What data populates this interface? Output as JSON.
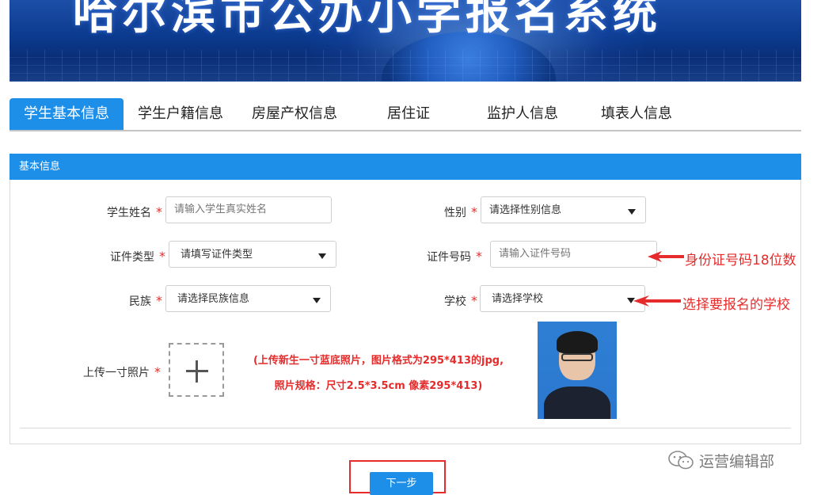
{
  "banner": {
    "title": "哈尔滨市公办小学报名系统"
  },
  "tabs": [
    {
      "label": "学生基本信息",
      "active": true
    },
    {
      "label": "学生户籍信息",
      "active": false
    },
    {
      "label": "房屋产权信息",
      "active": false
    },
    {
      "label": "居住证",
      "active": false
    },
    {
      "label": "监护人信息",
      "active": false
    },
    {
      "label": "填表人信息",
      "active": false
    }
  ],
  "panel": {
    "title": "基本信息",
    "required_mark": "*",
    "fields": {
      "student_name": {
        "label": "学生姓名",
        "placeholder": "请输入学生真实姓名"
      },
      "gender": {
        "label": "性别",
        "value": "请选择性别信息"
      },
      "id_type": {
        "label": "证件类型",
        "value": "请填写证件类型"
      },
      "id_number": {
        "label": "证件号码",
        "placeholder": "请输入证件号码"
      },
      "ethnicity": {
        "label": "民族",
        "value": "请选择民族信息"
      },
      "school": {
        "label": "学校",
        "value": "请选择学校"
      },
      "photo": {
        "label": "上传一寸照片"
      }
    },
    "photo_note": {
      "line1": "(上传新生一寸蓝底照片，图片格式为295*413的jpg,",
      "line2": "照片规格：尺寸2.5*3.5cm 像素295*413)"
    }
  },
  "annotations": {
    "id_number_hint": "身份证号码18位数",
    "school_hint": "选择要报名的学校"
  },
  "next_button": {
    "label": "下一步"
  },
  "watermark": {
    "text": "运营编辑部"
  },
  "colors": {
    "accent": "#1e8fe8",
    "required": "#e52b2b"
  }
}
